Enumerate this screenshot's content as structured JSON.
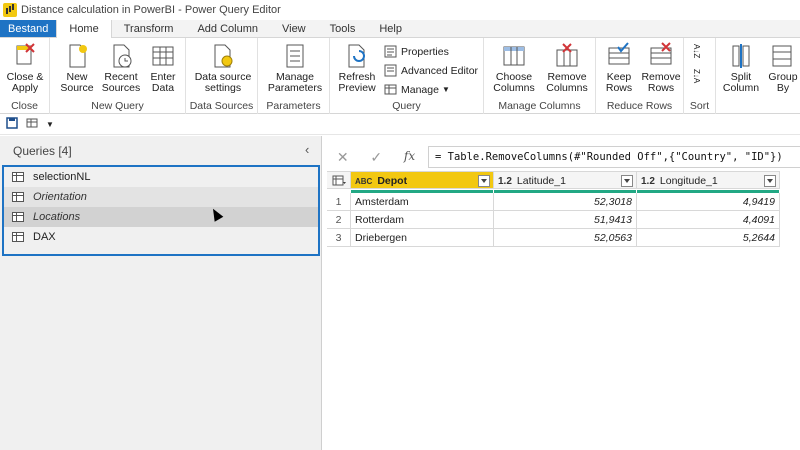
{
  "window": {
    "title": "Distance calculation in PowerBI - Power Query Editor"
  },
  "tabs": [
    "Bestand",
    "Home",
    "Transform",
    "Add Column",
    "View",
    "Tools",
    "Help"
  ],
  "ribbon": {
    "close": {
      "label": "Close",
      "close_apply": "Close & Apply"
    },
    "new_query": {
      "label": "New Query",
      "new_source": "New Source",
      "recent_sources": "Recent Sources",
      "enter_data": "Enter Data"
    },
    "data_sources": {
      "label": "Data Sources",
      "settings": "Data source settings"
    },
    "parameters": {
      "label": "Parameters",
      "manage": "Manage Parameters"
    },
    "query": {
      "label": "Query",
      "refresh_preview": "Refresh Preview",
      "properties": "Properties",
      "advanced_editor": "Advanced Editor",
      "manage": "Manage"
    },
    "manage_columns": {
      "label": "Manage Columns",
      "choose_columns": "Choose Columns",
      "remove_columns": "Remove Columns"
    },
    "reduce_rows": {
      "label": "Reduce Rows",
      "keep_rows": "Keep Rows",
      "remove_rows": "Remove Rows"
    },
    "sort": {
      "label": "Sort",
      "asc": "A↓Z",
      "desc": "Z↓A"
    },
    "transform": {
      "split_column": "Split Column",
      "group_by": "Group By"
    }
  },
  "queries": {
    "header": "Queries [4]",
    "items": [
      {
        "label": "selectionNL",
        "italic": false
      },
      {
        "label": "Orientation",
        "italic": true
      },
      {
        "label": "Locations",
        "italic": true
      },
      {
        "label": "DAX",
        "italic": false
      }
    ]
  },
  "formula": "= Table.RemoveColumns(#\"Rounded Off\",{\"Country\", \"ID\"})",
  "table": {
    "columns": [
      {
        "type_icon": "ABC",
        "name": "Depot"
      },
      {
        "type_icon": "1.2",
        "name": "Latitude_1"
      },
      {
        "type_icon": "1.2",
        "name": "Longitude_1"
      }
    ],
    "rows": [
      {
        "n": "1",
        "depot": "Amsterdam",
        "lat": "52,3018",
        "lon": "4,9419"
      },
      {
        "n": "2",
        "depot": "Rotterdam",
        "lat": "51,9413",
        "lon": "4,4091"
      },
      {
        "n": "3",
        "depot": "Driebergen",
        "lat": "52,0563",
        "lon": "5,2644"
      }
    ]
  },
  "colors": {
    "accent": "#1e73c4",
    "depot_header": "#f2c811",
    "quality_bar": "#22a884"
  }
}
